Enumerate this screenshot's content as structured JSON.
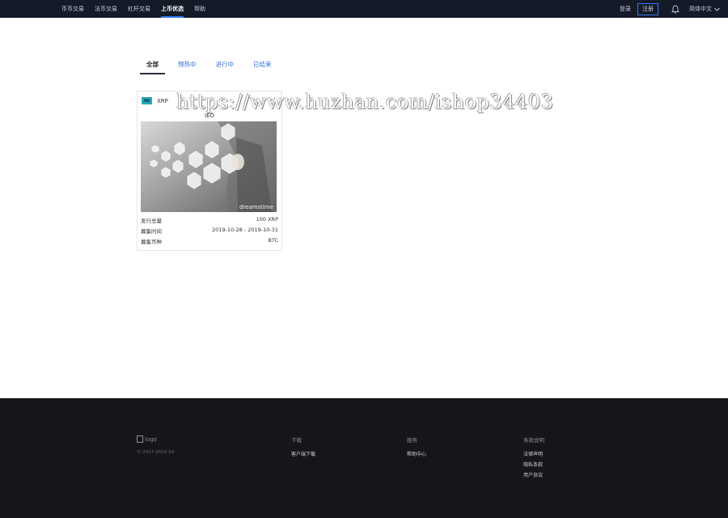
{
  "nav": {
    "links": [
      "币币交易",
      "法币交易",
      "杠杆交易",
      "上币优选",
      "帮助"
    ],
    "active_index": 3,
    "login": "登录",
    "register": "注册",
    "language": "简体中文"
  },
  "tabs": [
    "全部",
    "预热中",
    "进行中",
    "已结束"
  ],
  "active_tab": 0,
  "card": {
    "coin": "XRP",
    "type": "IEO",
    "image_watermark": "dreamstime",
    "rows": [
      {
        "label": "发行总量",
        "value": "100 XRP"
      },
      {
        "label": "募集时间",
        "value": "2019-10-28 - 2019-10-31"
      },
      {
        "label": "募集币种",
        "value": "BTC"
      }
    ]
  },
  "watermark": "https://www.huzhan.com/ishop34403",
  "footer": {
    "logo": "logo",
    "copyright": "© 2017-2019 XX",
    "columns": [
      {
        "title": "下载",
        "links": [
          "客户端下载"
        ]
      },
      {
        "title": "服务",
        "links": [
          "帮助中心"
        ]
      },
      {
        "title": "条款说明",
        "links": [
          "法律声明",
          "隐私条款",
          "用户协议"
        ]
      }
    ]
  },
  "colors": {
    "nav_bg": "#151a28",
    "accent": "#2f7cf6",
    "footer_bg": "#15161b",
    "tab_link": "#2f6fd6"
  }
}
